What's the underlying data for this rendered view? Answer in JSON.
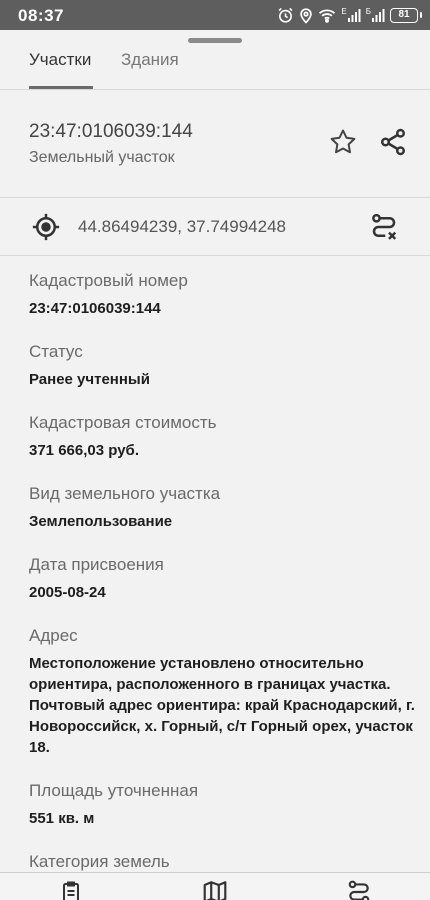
{
  "status_bar": {
    "time": "08:37",
    "network_e": "E",
    "network_b": "Б",
    "battery": "81",
    "icons": [
      "alarm-icon",
      "location-icon",
      "wifi-icon",
      "signal-icon",
      "signal-icon",
      "battery-icon"
    ]
  },
  "tabs": [
    {
      "label": "Участки",
      "active": true
    },
    {
      "label": "Здания",
      "active": false
    }
  ],
  "parcel": {
    "number": "23:47:0106039:144",
    "type": "Земельный участок",
    "actions": [
      "star-icon",
      "share-icon"
    ]
  },
  "coordinates": {
    "text": "44.86494239, 37.74994248",
    "icons": [
      "target-icon",
      "route-icon"
    ]
  },
  "fields": [
    {
      "label": "Кадастровый номер",
      "value": "23:47:0106039:144"
    },
    {
      "label": "Статус",
      "value": "Ранее учтенный"
    },
    {
      "label": "Кадастровая стоимость",
      "value": "371 666,03 руб."
    },
    {
      "label": "Вид земельного участка",
      "value": "Землепользование"
    },
    {
      "label": "Дата присвоения",
      "value": "2005-08-24"
    },
    {
      "label": "Адрес",
      "value": "Местоположение установлено относительно ориентира, расположенного в границах участка. Почтовый адрес ориентира: край Краснодарский, г. Новороссийск, х. Горный, с/т Горный орех, участок 18."
    },
    {
      "label": "Площадь уточненная",
      "value": "551 кв. м"
    },
    {
      "label": "Категория земель",
      "value": ""
    }
  ],
  "bottom_nav": [
    "clipboard-icon",
    "map-icon",
    "route-icon"
  ]
}
